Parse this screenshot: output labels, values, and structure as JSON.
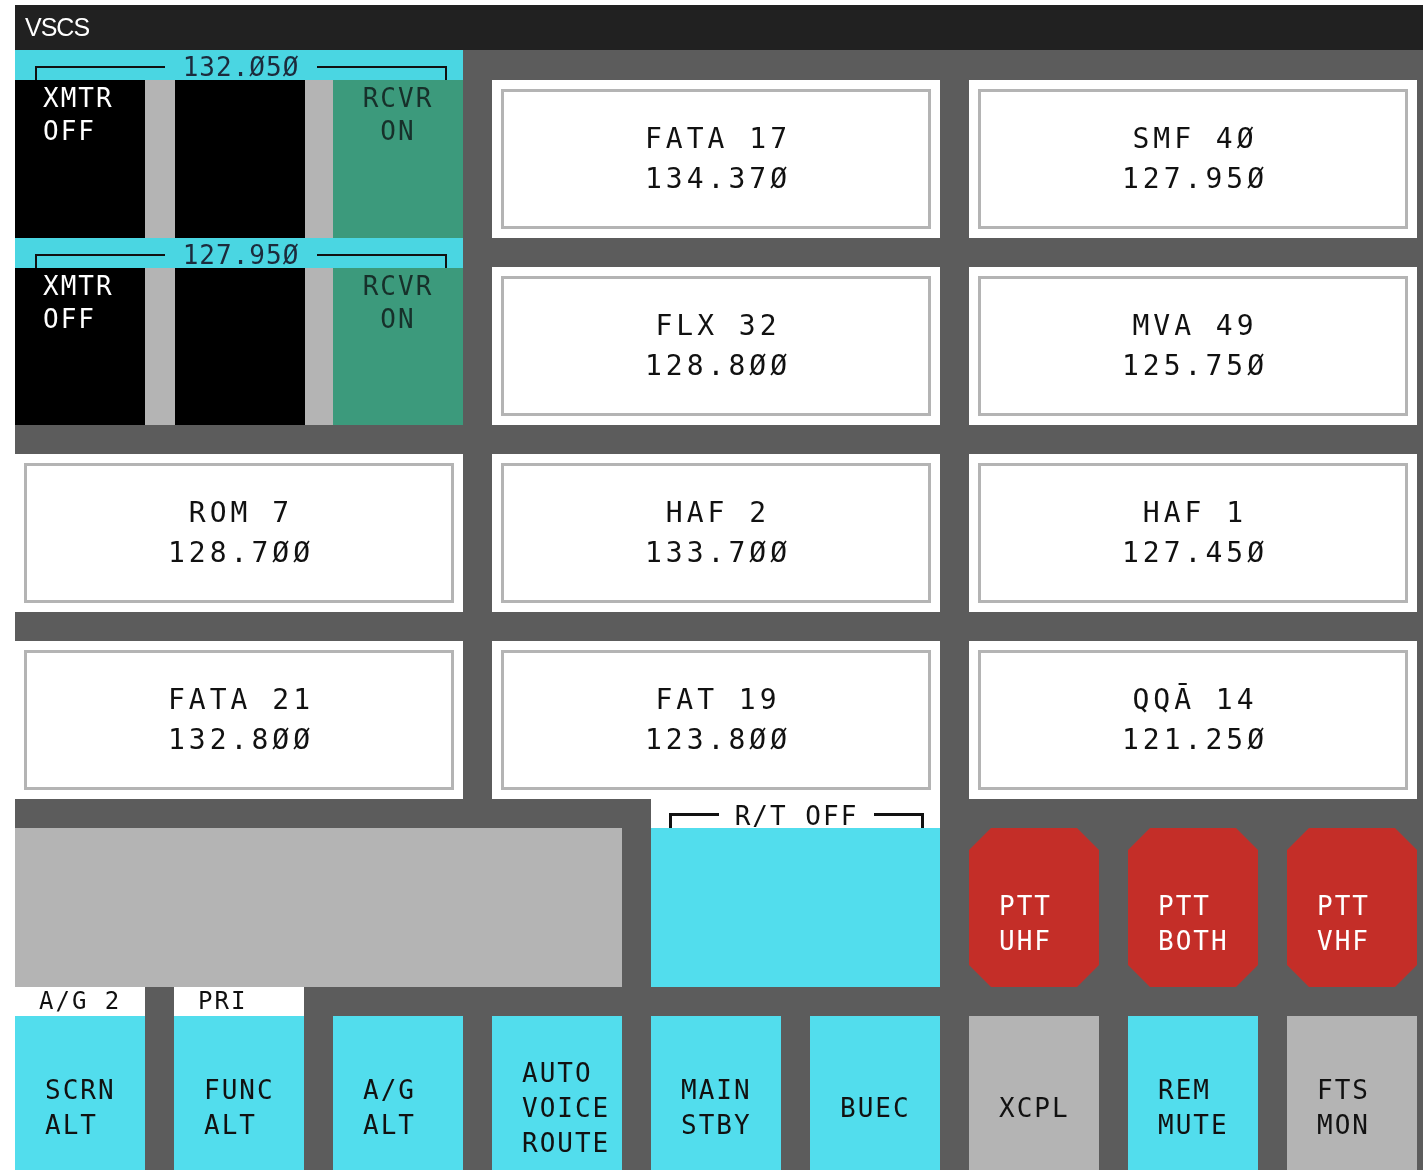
{
  "window": {
    "title": "VSCS"
  },
  "radios": [
    {
      "frequency": "132.Ø5Ø",
      "xmtr": "XMTR\nOFF",
      "rcvr": "RCVR\nON"
    },
    {
      "frequency": "127.95Ø",
      "xmtr": "XMTR\nOFF",
      "rcvr": "RCVR\nON"
    }
  ],
  "channels": [
    {
      "name": "FATA 17",
      "frequency": "134.37Ø"
    },
    {
      "name": "SMF 4Ø",
      "frequency": "127.95Ø"
    },
    {
      "name": "FLX 32",
      "frequency": "128.8ØØ"
    },
    {
      "name": "MVA 49",
      "frequency": "125.75Ø"
    },
    {
      "name": "ROM 7",
      "frequency": "128.7ØØ"
    },
    {
      "name": "HAF 2",
      "frequency": "133.7ØØ"
    },
    {
      "name": "HAF 1",
      "frequency": "127.45Ø"
    },
    {
      "name": "FATA 21",
      "frequency": "132.8ØØ"
    },
    {
      "name": "FAT 19",
      "frequency": "123.8ØØ"
    },
    {
      "name": "QQĀ 14",
      "frequency": "121.25Ø"
    }
  ],
  "rt": {
    "label": "R/T OFF"
  },
  "ptt": [
    {
      "label": "PTT\nUHF"
    },
    {
      "label": "PTT\nBOTH"
    },
    {
      "label": "PTT\nVHF"
    }
  ],
  "keys": [
    {
      "caption": "A/G 2",
      "label": "SCRN\nALT",
      "color": "#52dded"
    },
    {
      "caption": "PRI",
      "label": "FUNC\nALT",
      "color": "#52dded"
    },
    {
      "label": "A/G\nALT",
      "color": "#52dded"
    },
    {
      "label": "AUTO\nVOICE\nROUTE",
      "color": "#52dded"
    },
    {
      "label": "MAIN\nSTBY",
      "color": "#52dded"
    },
    {
      "label": "BUEC",
      "color": "#52dded"
    },
    {
      "label": "XCPL",
      "color": "#b4b4b4"
    },
    {
      "label": "REM\nMUTE",
      "color": "#52dded"
    },
    {
      "label": "FTS\nMON",
      "color": "#b4b4b4"
    }
  ]
}
